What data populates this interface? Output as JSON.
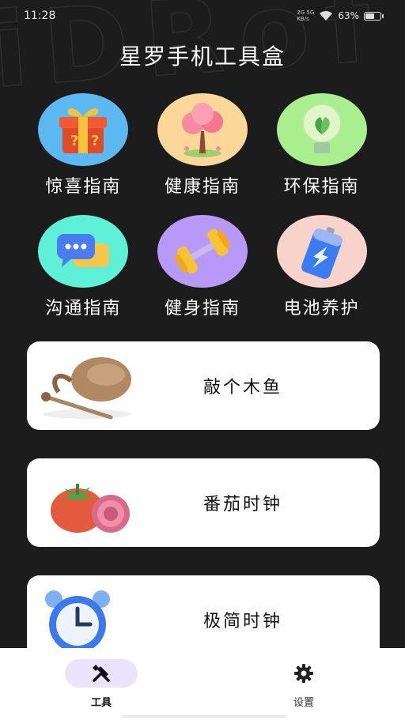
{
  "status_bar": {
    "time": "11:28",
    "network_line1": "2G 5G",
    "network_line2": "KB/s",
    "battery_percent": "63%",
    "battery_level": 0.63
  },
  "background_text": "iDRof",
  "header": {
    "title": "星罗手机工具盒"
  },
  "grid": [
    {
      "label": "惊喜指南",
      "icon": "gift-icon",
      "color": "#5bb8f0"
    },
    {
      "label": "健康指南",
      "icon": "tree-icon",
      "color": "#fcd79a"
    },
    {
      "label": "环保指南",
      "icon": "eco-bulb-icon",
      "color": "#a9ee8f"
    },
    {
      "label": "沟通指南",
      "icon": "chat-icon",
      "color": "#5ff0d8"
    },
    {
      "label": "健身指南",
      "icon": "dumbbell-icon",
      "color": "#b79af8"
    },
    {
      "label": "电池养护",
      "icon": "battery-icon",
      "color": "#f8d3cb"
    }
  ],
  "cards": [
    {
      "label": "敲个木鱼",
      "icon": "wooden-fish-icon"
    },
    {
      "label": "番茄时钟",
      "icon": "tomato-icon"
    },
    {
      "label": "极简时钟",
      "icon": "alarm-clock-icon"
    }
  ],
  "tabbar": {
    "tools": {
      "label": "工具",
      "icon": "tools-icon",
      "active": true
    },
    "settings": {
      "label": "设置",
      "icon": "gear-icon",
      "active": false
    }
  },
  "colors": {
    "background": "#1c1c1c",
    "accent_pill": "#e9e3fb",
    "card": "#ffffff"
  }
}
